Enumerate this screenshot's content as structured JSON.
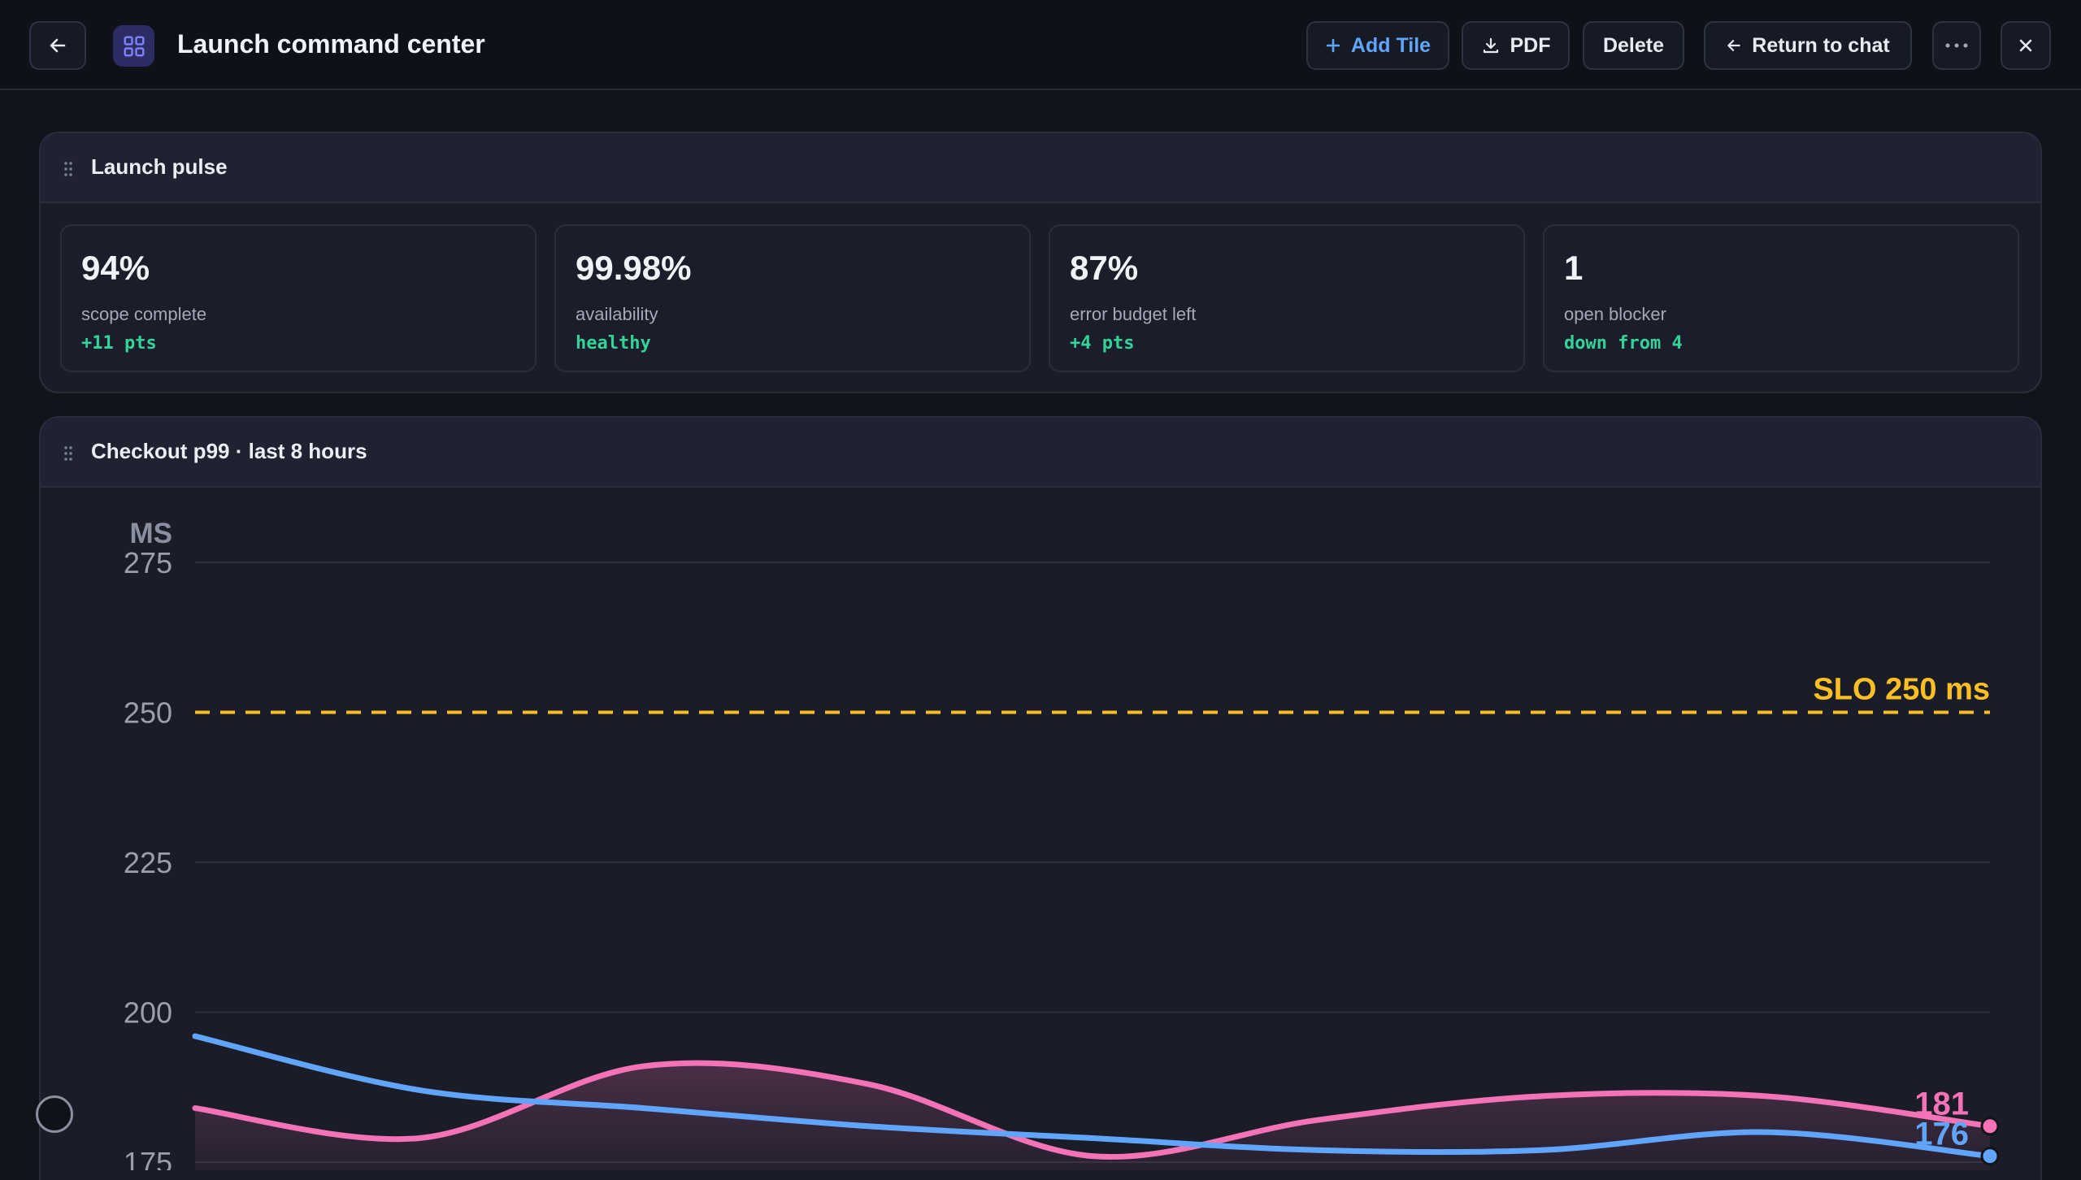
{
  "header": {
    "title": "Launch command center",
    "buttons": {
      "add_tile": "Add Tile",
      "pdf": "PDF",
      "delete": "Delete",
      "return_chat": "Return to chat"
    },
    "icons": [
      "arrow-left-icon",
      "grid-icon",
      "plus-icon",
      "download-icon",
      "arrow-left-small-icon",
      "more-horizontal-icon",
      "close-icon"
    ],
    "colors": {
      "accent": "#60a5fa",
      "app_icon_bg": "#2b2d63"
    }
  },
  "pulse": {
    "title": "Launch pulse",
    "kpis": [
      {
        "value": "94%",
        "label": "scope complete",
        "delta": "+11 pts"
      },
      {
        "value": "99.98%",
        "label": "availability",
        "delta": "healthy"
      },
      {
        "value": "87%",
        "label": "error budget left",
        "delta": "+4 pts"
      },
      {
        "value": "1",
        "label": "open blocker",
        "delta": "down from 4"
      }
    ],
    "delta_color": "#34d399"
  },
  "chart_panel": {
    "title": "Checkout p99 · last 8 hours"
  },
  "chart_data": {
    "type": "line",
    "ylabel": "MS",
    "y_ticks": [
      "275",
      "250",
      "225",
      "200",
      "175"
    ],
    "ylim": [
      175,
      275
    ],
    "x": [
      0,
      1,
      2,
      3,
      4,
      5,
      6,
      7,
      8
    ],
    "series": [
      {
        "color": "#f472b6",
        "values": [
          184,
          179,
          191,
          188,
          176,
          182,
          186,
          186,
          181
        ],
        "end_label": "181"
      },
      {
        "color": "#60a5fa",
        "values": [
          196,
          187,
          184,
          181,
          179,
          177,
          177,
          180,
          176
        ],
        "end_label": "176"
      }
    ],
    "threshold": {
      "value": 250,
      "label": "SLO 250 ms",
      "color": "#fbbf24"
    },
    "grid": true
  }
}
